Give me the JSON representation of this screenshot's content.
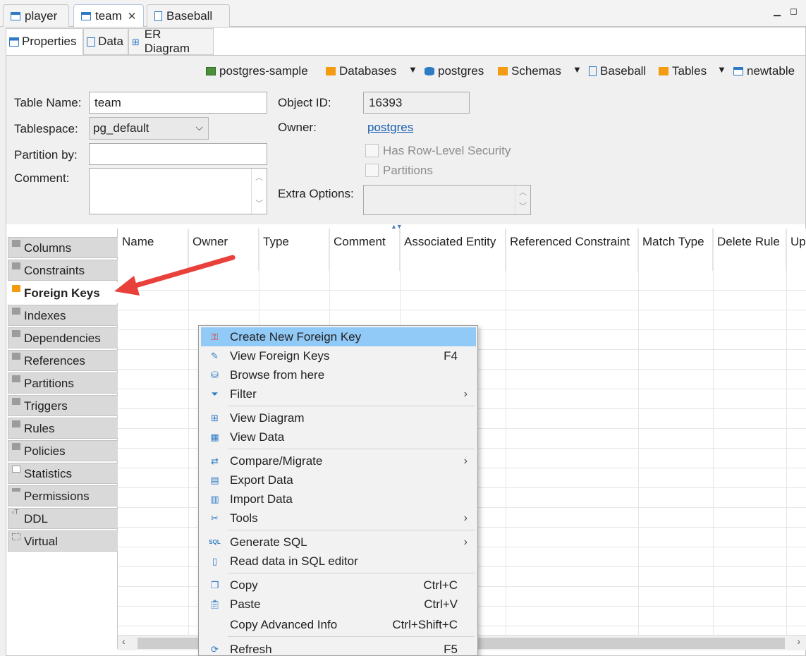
{
  "editor_tabs": [
    {
      "label": "player",
      "icon": "table-icon"
    },
    {
      "label": "team",
      "icon": "table-icon",
      "closable": true
    },
    {
      "label": "Baseball",
      "icon": "document-icon"
    }
  ],
  "view_tabs": [
    {
      "label": "Properties",
      "icon": "properties-icon"
    },
    {
      "label": "Data",
      "icon": "data-icon"
    },
    {
      "label": "ER Diagram",
      "icon": "er-diagram-icon"
    }
  ],
  "breadcrumb": [
    {
      "label": "postgres-sample",
      "icon": "connection-icon"
    },
    {
      "label": "Databases",
      "icon": "folder-icon",
      "dropdown": true
    },
    {
      "label": "postgres",
      "icon": "database-icon"
    },
    {
      "label": "Schemas",
      "icon": "folder-icon",
      "dropdown": true
    },
    {
      "label": "Baseball",
      "icon": "schema-icon"
    },
    {
      "label": "Tables",
      "icon": "folder-icon",
      "dropdown": true
    },
    {
      "label": "newtable",
      "icon": "table-icon"
    }
  ],
  "form": {
    "table_name_label": "Table Name:",
    "table_name_value": "team",
    "tablespace_label": "Tablespace:",
    "tablespace_value": "pg_default",
    "partition_by_label": "Partition by:",
    "partition_by_value": "",
    "comment_label": "Comment:",
    "comment_value": "",
    "object_id_label": "Object ID:",
    "object_id_value": "16393",
    "owner_label": "Owner:",
    "owner_value": "postgres",
    "row_level_security_label": "Has Row-Level Security",
    "partitions_label": "Partitions",
    "extra_options_label": "Extra Options:",
    "extra_options_value": ""
  },
  "folders": [
    {
      "label": "Columns"
    },
    {
      "label": "Constraints"
    },
    {
      "label": "Foreign Keys",
      "selected": true
    },
    {
      "label": "Indexes"
    },
    {
      "label": "Dependencies"
    },
    {
      "label": "References"
    },
    {
      "label": "Partitions"
    },
    {
      "label": "Triggers"
    },
    {
      "label": "Rules"
    },
    {
      "label": "Policies"
    },
    {
      "label": "Statistics"
    },
    {
      "label": "Permissions"
    },
    {
      "label": "DDL"
    },
    {
      "label": "Virtual"
    }
  ],
  "grid_columns": [
    "Name",
    "Owner",
    "Type",
    "Comment",
    "Associated Entity",
    "Referenced Constraint",
    "Match Type",
    "Delete Rule",
    "Up"
  ],
  "context_menu": {
    "items": [
      {
        "label": "Create New Foreign Key",
        "icon": "create-fk-icon",
        "highlighted": true
      },
      {
        "label": "View Foreign Keys",
        "icon": "pencil-icon",
        "shortcut": "F4"
      },
      {
        "label": "Browse from here",
        "icon": "database-icon"
      },
      {
        "label": "Filter",
        "icon": "filter-icon",
        "submenu": true
      },
      {
        "label": "View Diagram",
        "icon": "diagram-icon"
      },
      {
        "label": "View Data",
        "icon": "data-icon"
      },
      {
        "label": "Compare/Migrate",
        "icon": "compare-icon",
        "submenu": true
      },
      {
        "label": "Export Data",
        "icon": "export-icon"
      },
      {
        "label": "Import Data",
        "icon": "import-icon"
      },
      {
        "label": "Tools",
        "icon": "tools-icon",
        "submenu": true
      },
      {
        "label": "Generate SQL",
        "icon": "sql-icon",
        "submenu": true
      },
      {
        "label": "Read data in SQL editor",
        "icon": "sql-editor-icon"
      },
      {
        "label": "Copy",
        "icon": "copy-icon",
        "shortcut": "Ctrl+C"
      },
      {
        "label": "Paste",
        "icon": "paste-icon",
        "shortcut": "Ctrl+V"
      },
      {
        "label": "Copy Advanced Info",
        "icon": "",
        "shortcut": "Ctrl+Shift+C"
      },
      {
        "label": "Refresh",
        "icon": "refresh-icon",
        "shortcut": "F5"
      }
    ]
  },
  "colors": {
    "accent": "#2e7bc4",
    "highlight": "#91c9f7",
    "selected_folder": "#f39c12",
    "annotation_arrow": "#e8403a"
  }
}
